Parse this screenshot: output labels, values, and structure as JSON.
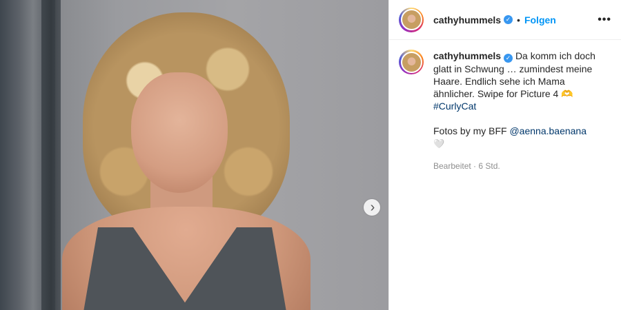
{
  "post": {
    "username": "cathyhummels",
    "verified_glyph": "✓",
    "dot": "•",
    "follow_label": "Folgen",
    "more_label": "•••",
    "next_icon": "›"
  },
  "caption": {
    "username": "cathyhummels",
    "text": "Da komm ich doch glatt in Schwung … zumindest meine Haare. Endlich sehe ich Mama ähnlicher. Swipe for Picture 4 🫶",
    "hashtag": "#CurlyCat",
    "line2_prefix": "Fotos by my BFF ",
    "mention": "@aenna.baenana",
    "heart": "🤍",
    "edited_label": "Bearbeitet",
    "sep": " · ",
    "time": "6 Std."
  },
  "icons": {
    "verified": "verified-badge-icon",
    "next": "chevron-right-icon",
    "more": "more-options-icon"
  }
}
